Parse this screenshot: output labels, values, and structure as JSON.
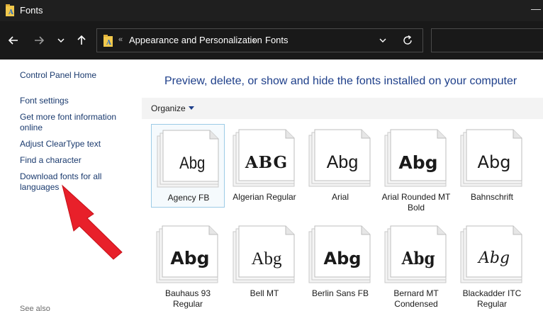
{
  "window": {
    "title": "Fonts",
    "minimize_glyph": "—"
  },
  "addressbar": {
    "chevrons": "«",
    "segments": [
      "Appearance and Personalization",
      "Fonts"
    ],
    "separator": "›"
  },
  "leftpane": {
    "links": [
      "Control Panel Home",
      "Font settings",
      "Get more font information online",
      "Adjust ClearType text",
      "Find a character",
      "Download fonts for all languages"
    ],
    "see_also": "See also"
  },
  "main": {
    "title": "Preview, delete, or show and hide the fonts installed on your computer",
    "organize_label": "Organize",
    "fonts": [
      {
        "name": "Agency FB",
        "preview": "Abg",
        "selected": true
      },
      {
        "name": "Algerian Regular",
        "preview": "ABG"
      },
      {
        "name": "Arial",
        "preview": "Abg"
      },
      {
        "name": "Arial Rounded MT Bold",
        "preview": "Abg"
      },
      {
        "name": "Bahnschrift",
        "preview": "Abg"
      },
      {
        "name": "Bauhaus 93 Regular",
        "preview": "Abg"
      },
      {
        "name": "Bell MT",
        "preview": "Abg"
      },
      {
        "name": "Berlin Sans FB",
        "preview": "Abg"
      },
      {
        "name": "Bernard MT Condensed",
        "preview": "Abg"
      },
      {
        "name": "Blackadder ITC Regular",
        "preview": "Abg"
      }
    ]
  },
  "colors": {
    "annotation_arrow": "#e8202a",
    "link": "#1a3a6e",
    "heading": "#1e3f8a"
  }
}
